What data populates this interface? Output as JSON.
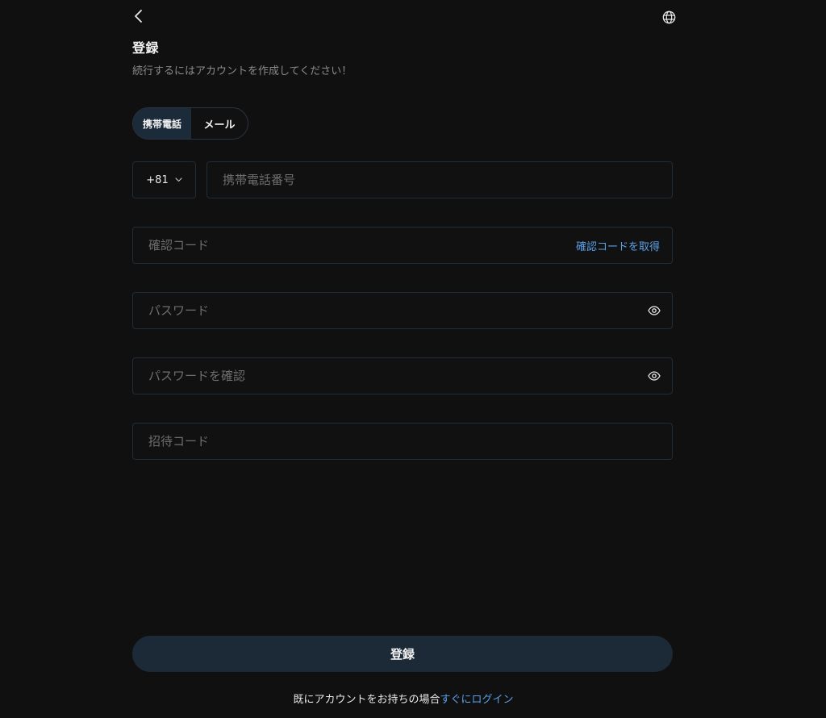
{
  "header": {
    "back_icon": "chevron-left-icon",
    "language_icon": "globe-icon"
  },
  "title": "登録",
  "subtitle": "続行するにはアカウントを作成してください！",
  "tabs": [
    {
      "label": "携帯電話",
      "active": true
    },
    {
      "label": "メール",
      "active": false
    }
  ],
  "form": {
    "country_code": "+81",
    "phone_placeholder": "携帯電話番号",
    "code_placeholder": "確認コード",
    "get_code_label": "確認コードを取得",
    "password_placeholder": "パスワード",
    "confirm_password_placeholder": "パスワードを確認",
    "invite_placeholder": "招待コード"
  },
  "submit_label": "登録",
  "footer": {
    "prefix": "既にアカウントをお持ちの場合",
    "link": "すぐにログイン"
  },
  "colors": {
    "background": "#101010",
    "accent": "#5aa0e6",
    "button": "#1c2a37",
    "field_border": "#1f2c3a"
  }
}
